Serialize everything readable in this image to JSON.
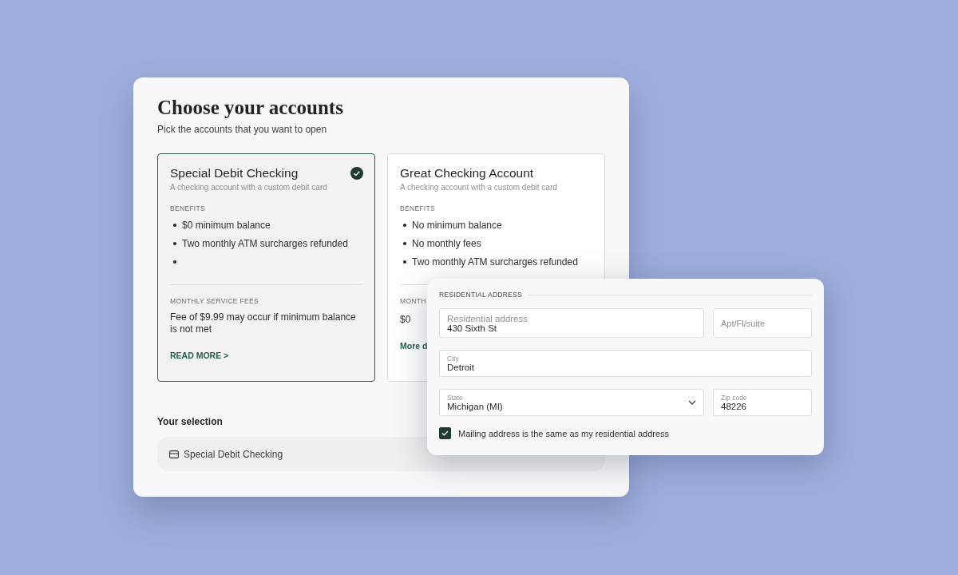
{
  "title": "Choose your accounts",
  "subtitle": "Pick the accounts that you want to open",
  "accounts": [
    {
      "name": "Special Debit Checking",
      "description": "A checking account with a custom debit card",
      "selected": true,
      "benefits_label": "BENEFITS",
      "benefits": [
        {
          "kind": "text",
          "text": "$0 minimum balance"
        },
        {
          "kind": "text",
          "text": "Two monthly ATM surcharges refunded"
        },
        {
          "kind": "blank"
        }
      ],
      "fees_label": "MONTHLY SERVICE FEES",
      "fees": "Fee of $9.99 may occur if minimum balance is not met",
      "link": "READ MORE >"
    },
    {
      "name": "Great Checking Account",
      "description": "A checking account with a custom debit card",
      "selected": false,
      "benefits_label": "BENEFITS",
      "benefits": [
        {
          "kind": "text",
          "text": "No minimum balance"
        },
        {
          "kind": "text",
          "text": "No monthly fees"
        },
        {
          "kind": "text",
          "text": "Two monthly ATM surcharges refunded"
        }
      ],
      "fees_label": "MONTH",
      "fees": "$0",
      "link": "More d"
    }
  ],
  "selection": {
    "label": "Your selection",
    "value": "Special Debit Checking"
  },
  "address": {
    "heading": "RESIDENTIAL ADDRESS",
    "fields": [
      {
        "label": "Residential address",
        "value": "430 Sixth St",
        "kind": "text"
      },
      {
        "placeholder": "Apt/Fl/suite",
        "kind": "text"
      },
      {
        "label": "City",
        "value": "Detroit",
        "kind": "text"
      },
      {
        "label": "State",
        "value": "Michigan (MI)",
        "kind": "select"
      },
      {
        "label": "Zip code",
        "value": "48226",
        "kind": "text"
      }
    ],
    "mailing_same": {
      "label": "Mailing address is the same as my residential address",
      "checked": true
    }
  }
}
